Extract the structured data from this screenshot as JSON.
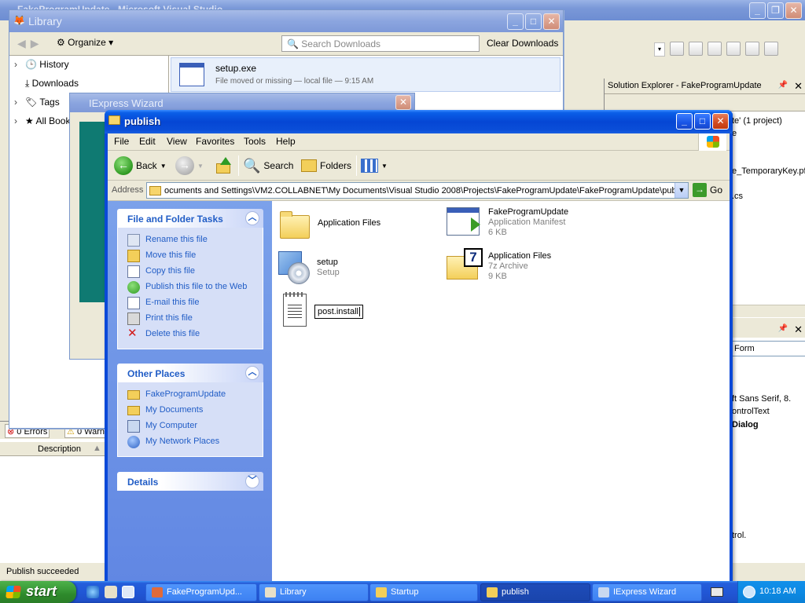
{
  "vs": {
    "title": "FakeProgramUpdate - Microsoft Visual Studio",
    "solution_explorer": {
      "title": "Solution Explorer - FakeProgramUpdate",
      "lines": [
        "te' (1 project)",
        "e",
        "e_TemporaryKey.pfx",
        ".cs"
      ]
    },
    "properties": {
      "combo": "Form",
      "rows": [
        "ft Sans Serif, 8.",
        "ontrolText",
        "Dialog",
        "trol."
      ]
    },
    "error_list": {
      "errors_tab": "0 Errors",
      "warnings_tab": "0 Warn",
      "description_col": "Description"
    },
    "status": "Publish succeeded"
  },
  "library": {
    "title": "Library",
    "organize_label": "Organize",
    "search_placeholder": "Search Downloads",
    "clear_label": "Clear Downloads",
    "sidebar": [
      {
        "label": "History",
        "icon": "clock-icon",
        "expand": true
      },
      {
        "label": "Downloads",
        "icon": "download-icon",
        "expand": false
      },
      {
        "label": "Tags",
        "icon": "tag-icon",
        "expand": true
      },
      {
        "label": "All Book",
        "icon": "star-icon",
        "expand": true
      }
    ],
    "download": {
      "name": "setup.exe",
      "status": "File moved or missing — local file — 9:15 AM"
    }
  },
  "iexpress": {
    "title": "IExpress Wizard"
  },
  "publish": {
    "title": "publish",
    "menu": [
      "File",
      "Edit",
      "View",
      "Favorites",
      "Tools",
      "Help"
    ],
    "toolbar": {
      "back": "Back",
      "search": "Search",
      "folders": "Folders"
    },
    "address": {
      "label": "Address",
      "path": "ocuments and Settings\\VM2.COLLABNET\\My Documents\\Visual Studio 2008\\Projects\\FakeProgramUpdate\\FakeProgramUpdate\\publish",
      "go": "Go"
    },
    "tasks": {
      "file_folder": {
        "title": "File and Folder Tasks",
        "links": [
          {
            "label": "Rename this file",
            "icon": "rename-icon"
          },
          {
            "label": "Move this file",
            "icon": "move-icon"
          },
          {
            "label": "Copy this file",
            "icon": "copy-icon"
          },
          {
            "label": "Publish this file to the Web",
            "icon": "web-publish-icon"
          },
          {
            "label": "E-mail this file",
            "icon": "email-icon"
          },
          {
            "label": "Print this file",
            "icon": "print-icon"
          },
          {
            "label": "Delete this file",
            "icon": "delete-icon"
          }
        ]
      },
      "other_places": {
        "title": "Other Places",
        "links": [
          {
            "label": "FakeProgramUpdate",
            "icon": "folder-icon"
          },
          {
            "label": "My Documents",
            "icon": "my-documents-icon"
          },
          {
            "label": "My Computer",
            "icon": "my-computer-icon"
          },
          {
            "label": "My Network Places",
            "icon": "network-icon"
          }
        ]
      },
      "details": {
        "title": "Details"
      }
    },
    "files": [
      {
        "name": "Application Files",
        "type": "",
        "size": "",
        "icon": "folder-icon"
      },
      {
        "name": "FakeProgramUpdate",
        "type": "Application Manifest",
        "size": "6 KB",
        "icon": "manifest-icon"
      },
      {
        "name": "setup",
        "type": "Setup",
        "size": "",
        "icon": "setup-icon"
      },
      {
        "name": "Application Files",
        "type": "7z Archive",
        "size": "9 KB",
        "icon": "7z-archive-icon"
      },
      {
        "name": "post.install",
        "type": "",
        "size": "",
        "icon": "notepad-icon",
        "renaming": true
      }
    ]
  },
  "taskbar": {
    "start": "start",
    "buttons": [
      {
        "label": "FakeProgramUpd...",
        "active": false
      },
      {
        "label": "Library",
        "active": false
      },
      {
        "label": "Startup",
        "active": false
      },
      {
        "label": "publish",
        "active": true
      },
      {
        "label": "IExpress Wizard",
        "active": false
      }
    ],
    "clock": "10:18 AM"
  },
  "colors": {
    "xp_title_blue": "#0a49d8",
    "task_pane_blue": "#6187e3",
    "link_blue": "#215dc6",
    "start_green": "#3a9a38"
  }
}
